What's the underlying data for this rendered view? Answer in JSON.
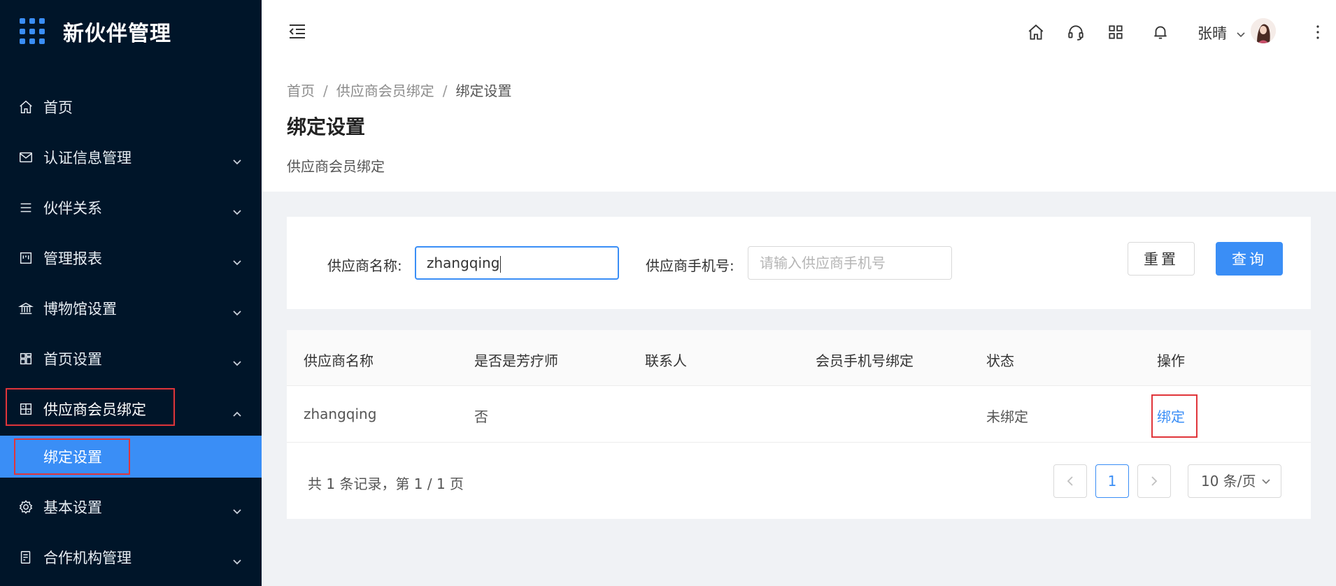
{
  "app": {
    "title": "新伙伴管理"
  },
  "sidebar": {
    "items": [
      {
        "label": "首页",
        "icon": "home-icon",
        "has_arrow": false
      },
      {
        "label": "认证信息管理",
        "icon": "mail-icon",
        "has_arrow": true
      },
      {
        "label": "伙伴关系",
        "icon": "list-icon",
        "has_arrow": true
      },
      {
        "label": "管理报表",
        "icon": "report-icon",
        "has_arrow": true
      },
      {
        "label": "博物馆设置",
        "icon": "museum-icon",
        "has_arrow": true
      },
      {
        "label": "首页设置",
        "icon": "layout-icon",
        "has_arrow": true
      },
      {
        "label": "供应商会员绑定",
        "icon": "bind-icon",
        "has_arrow": true,
        "open": true
      },
      {
        "label": "基本设置",
        "icon": "gear-icon",
        "has_arrow": true
      },
      {
        "label": "合作机构管理",
        "icon": "org-icon",
        "has_arrow": true
      }
    ],
    "submenu": {
      "label": "绑定设置",
      "active": true
    }
  },
  "header": {
    "icons": [
      "home-icon",
      "headset-icon",
      "apps-icon",
      "bell-icon"
    ],
    "user": {
      "name": "张晴"
    }
  },
  "breadcrumb": {
    "items": [
      "首页",
      "供应商会员绑定",
      "绑定设置"
    ],
    "separator": "/"
  },
  "page": {
    "title": "绑定设置",
    "description": "供应商会员绑定"
  },
  "search": {
    "name_label": "供应商名称:",
    "name_value": "zhangqing",
    "phone_label": "供应商手机号:",
    "phone_placeholder": "请输入供应商手机号",
    "reset_label": "重置",
    "query_label": "查询"
  },
  "table": {
    "columns": [
      "供应商名称",
      "是否是芳疗师",
      "联系人",
      "会员手机号绑定",
      "状态",
      "操作"
    ],
    "rows": [
      {
        "name": "zhangqing",
        "is_therapist": "否",
        "contact": "",
        "phone_bound": "",
        "status": "未绑定",
        "action": "绑定"
      }
    ]
  },
  "pagination": {
    "total_text": "共 1 条记录，第 1 / 1 页",
    "current_page": "1",
    "page_size": "10 条/页"
  },
  "colors": {
    "sidebar_bg": "#001529",
    "accent": "#3a8ef6",
    "highlight_box": "#e0353a"
  }
}
